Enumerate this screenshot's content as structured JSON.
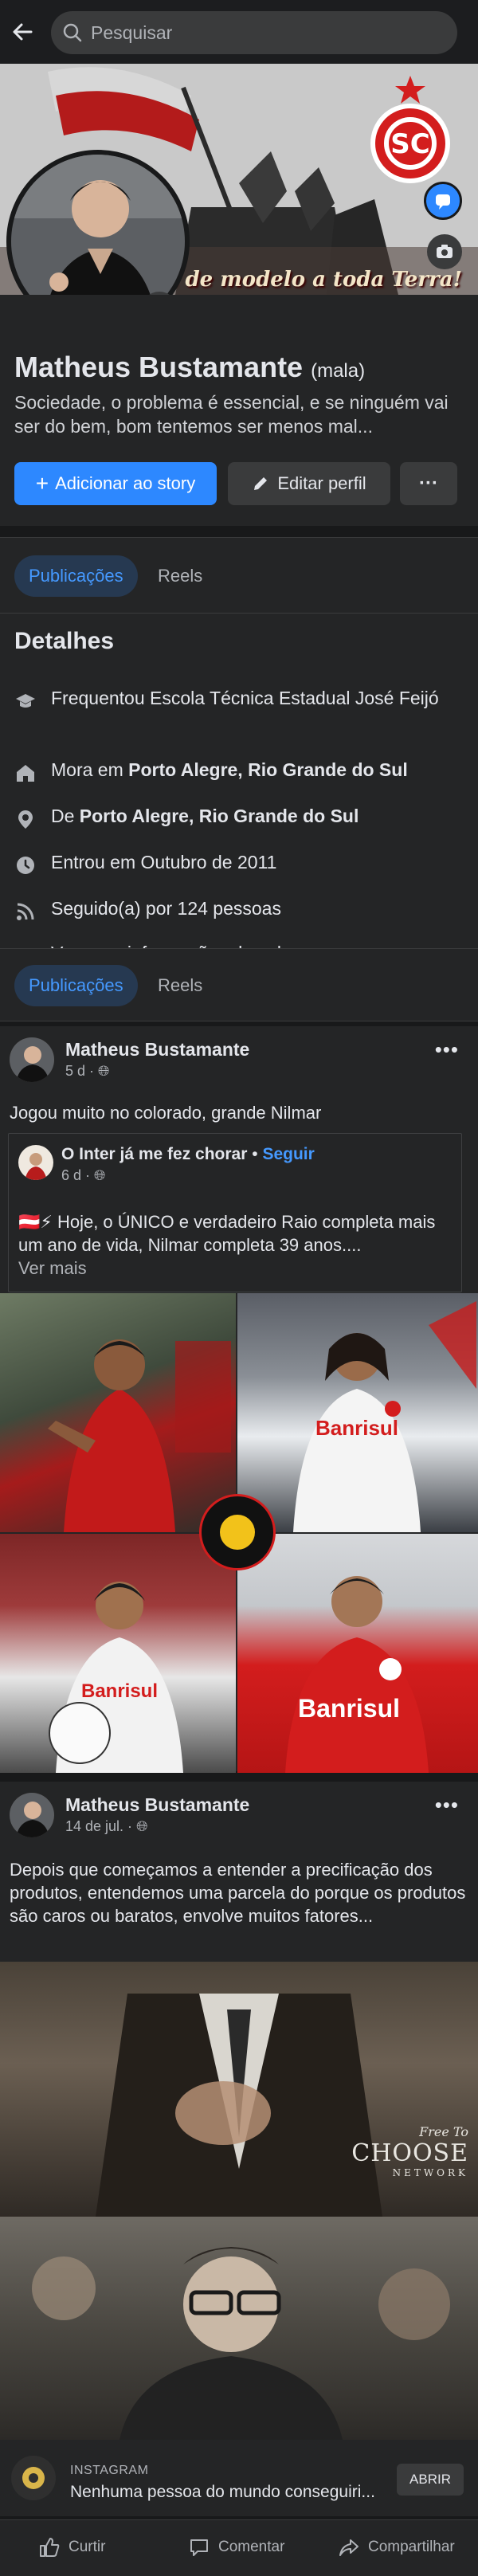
{
  "search": {
    "placeholder": "Pesquisar"
  },
  "cover": {
    "caption": "inhas de modelo a toda Terra!"
  },
  "profile": {
    "name": "Matheus Bustamante",
    "alt_name": "(mala)",
    "bio": "Sociedade, o problema é essencial, e se ninguém vai ser do bem, bom tentemos ser menos mal...",
    "buttons": {
      "add_story": "Adicionar ao story",
      "edit_profile": "Editar perfil",
      "more": "···"
    }
  },
  "tabs_top": {
    "posts": "Publicações",
    "reels": "Reels"
  },
  "details": {
    "title": "Detalhes",
    "items": [
      {
        "icon": "graduation-cap-icon",
        "text": "Frequentou Escola Técnica Estadual José Feijó"
      },
      {
        "icon": "home-icon",
        "prefix": "Mora em ",
        "bold": "Porto Alegre, Rio Grande do Sul"
      },
      {
        "icon": "location-pin-icon",
        "prefix": "De ",
        "bold": "Porto Alegre, Rio Grande do Sul"
      },
      {
        "icon": "clock-icon",
        "text": "Entrou em Outubro de 2011"
      },
      {
        "icon": "rss-icon",
        "text": "Seguido(a) por 124 pessoas"
      },
      {
        "icon": "ellipsis-icon",
        "text": "Ver suas informações de sobre..."
      }
    ]
  },
  "tabs_sticky": {
    "posts": "Publicações",
    "reels": "Reels"
  },
  "post1": {
    "author": "Matheus Bustamante",
    "time": "5 d ·",
    "text": "Jogou muito no colorado, grande Nilmar",
    "more": "•••",
    "shared": {
      "page": "O Inter já me fez chorar",
      "separator": "•",
      "follow": "Seguir",
      "time": "6 d ·",
      "emoji": "🇦🇹⚡",
      "text": " Hoje, o ÚNICO e verdadeiro Raio completa mais um ano de vida, Nilmar completa 39 anos....",
      "see_more": "Ver mais"
    },
    "photo_sponsor": "Banrisul"
  },
  "post2": {
    "author": "Matheus Bustamante",
    "time": "14 de jul. ·",
    "text": "Depois que começamos a entender a precificação dos produtos,  entendemos uma parcela do porque os produtos são caros ou baratos, envolve muitos fatores...",
    "more": "•••",
    "watermark": {
      "small": "Free To",
      "big": "CHOOSE",
      "network": "NETWORK"
    }
  },
  "ad": {
    "source": "INSTAGRAM",
    "title": "Nenhuma pessoa do mundo conseguiri...",
    "button": "ABRIR"
  },
  "actions": {
    "like": "Curtir",
    "comment": "Comentar",
    "share": "Compartilhar"
  },
  "colors": {
    "background": "#18191a",
    "card": "#242526",
    "accent": "#2d88ff",
    "inter_red": "#d31d1d"
  }
}
